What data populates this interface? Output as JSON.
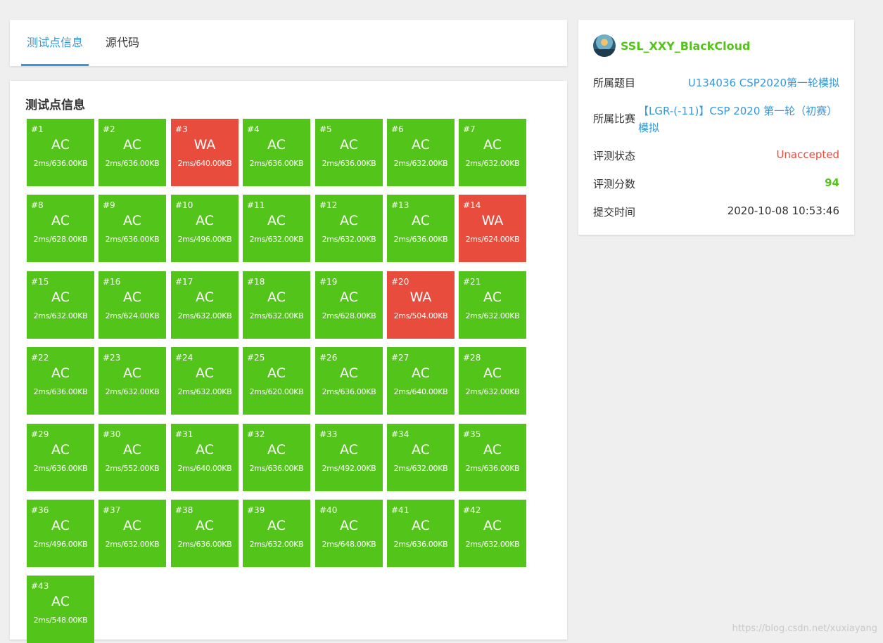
{
  "tabs": [
    {
      "label": "测试点信息",
      "active": true
    },
    {
      "label": "源代码",
      "active": false
    }
  ],
  "tests_section": {
    "title": "测试点信息",
    "cases": [
      {
        "num": "#1",
        "status": "AC",
        "meta": "2ms/636.00KB"
      },
      {
        "num": "#2",
        "status": "AC",
        "meta": "2ms/636.00KB"
      },
      {
        "num": "#3",
        "status": "WA",
        "meta": "2ms/640.00KB"
      },
      {
        "num": "#4",
        "status": "AC",
        "meta": "2ms/636.00KB"
      },
      {
        "num": "#5",
        "status": "AC",
        "meta": "2ms/636.00KB"
      },
      {
        "num": "#6",
        "status": "AC",
        "meta": "2ms/632.00KB"
      },
      {
        "num": "#7",
        "status": "AC",
        "meta": "2ms/632.00KB"
      },
      {
        "num": "#8",
        "status": "AC",
        "meta": "2ms/628.00KB"
      },
      {
        "num": "#9",
        "status": "AC",
        "meta": "2ms/636.00KB"
      },
      {
        "num": "#10",
        "status": "AC",
        "meta": "2ms/496.00KB"
      },
      {
        "num": "#11",
        "status": "AC",
        "meta": "2ms/632.00KB"
      },
      {
        "num": "#12",
        "status": "AC",
        "meta": "2ms/632.00KB"
      },
      {
        "num": "#13",
        "status": "AC",
        "meta": "2ms/636.00KB"
      },
      {
        "num": "#14",
        "status": "WA",
        "meta": "2ms/624.00KB"
      },
      {
        "num": "#15",
        "status": "AC",
        "meta": "2ms/632.00KB"
      },
      {
        "num": "#16",
        "status": "AC",
        "meta": "2ms/624.00KB"
      },
      {
        "num": "#17",
        "status": "AC",
        "meta": "2ms/632.00KB"
      },
      {
        "num": "#18",
        "status": "AC",
        "meta": "2ms/632.00KB"
      },
      {
        "num": "#19",
        "status": "AC",
        "meta": "2ms/628.00KB"
      },
      {
        "num": "#20",
        "status": "WA",
        "meta": "2ms/504.00KB"
      },
      {
        "num": "#21",
        "status": "AC",
        "meta": "2ms/632.00KB"
      },
      {
        "num": "#22",
        "status": "AC",
        "meta": "2ms/636.00KB"
      },
      {
        "num": "#23",
        "status": "AC",
        "meta": "2ms/632.00KB"
      },
      {
        "num": "#24",
        "status": "AC",
        "meta": "2ms/632.00KB"
      },
      {
        "num": "#25",
        "status": "AC",
        "meta": "2ms/620.00KB"
      },
      {
        "num": "#26",
        "status": "AC",
        "meta": "2ms/636.00KB"
      },
      {
        "num": "#27",
        "status": "AC",
        "meta": "2ms/640.00KB"
      },
      {
        "num": "#28",
        "status": "AC",
        "meta": "2ms/632.00KB"
      },
      {
        "num": "#29",
        "status": "AC",
        "meta": "2ms/636.00KB"
      },
      {
        "num": "#30",
        "status": "AC",
        "meta": "2ms/552.00KB"
      },
      {
        "num": "#31",
        "status": "AC",
        "meta": "2ms/640.00KB"
      },
      {
        "num": "#32",
        "status": "AC",
        "meta": "2ms/636.00KB"
      },
      {
        "num": "#33",
        "status": "AC",
        "meta": "2ms/492.00KB"
      },
      {
        "num": "#34",
        "status": "AC",
        "meta": "2ms/632.00KB"
      },
      {
        "num": "#35",
        "status": "AC",
        "meta": "2ms/636.00KB"
      },
      {
        "num": "#36",
        "status": "AC",
        "meta": "2ms/496.00KB"
      },
      {
        "num": "#37",
        "status": "AC",
        "meta": "2ms/632.00KB"
      },
      {
        "num": "#38",
        "status": "AC",
        "meta": "2ms/636.00KB"
      },
      {
        "num": "#39",
        "status": "AC",
        "meta": "2ms/632.00KB"
      },
      {
        "num": "#40",
        "status": "AC",
        "meta": "2ms/648.00KB"
      },
      {
        "num": "#41",
        "status": "AC",
        "meta": "2ms/636.00KB"
      },
      {
        "num": "#42",
        "status": "AC",
        "meta": "2ms/632.00KB"
      },
      {
        "num": "#43",
        "status": "AC",
        "meta": "2ms/548.00KB"
      }
    ]
  },
  "info": {
    "username": "SSL_XXY_BlackCloud",
    "problem_label": "所属题目",
    "problem_value": "U134036 CSP2020第一轮模拟",
    "contest_label": "所属比赛",
    "contest_value": "【LGR-(-11)】CSP 2020 第一轮（初赛）模拟",
    "status_label": "评测状态",
    "status_value": "Unaccepted",
    "score_label": "评测分数",
    "score_value": "94",
    "time_label": "提交时间",
    "time_value": "2020-10-08 10:53:46"
  },
  "colors": {
    "ac": "#52c41a",
    "wa": "#e74c3c",
    "accent": "#3498db"
  },
  "watermark": "https://blog.csdn.net/xuxiayang"
}
